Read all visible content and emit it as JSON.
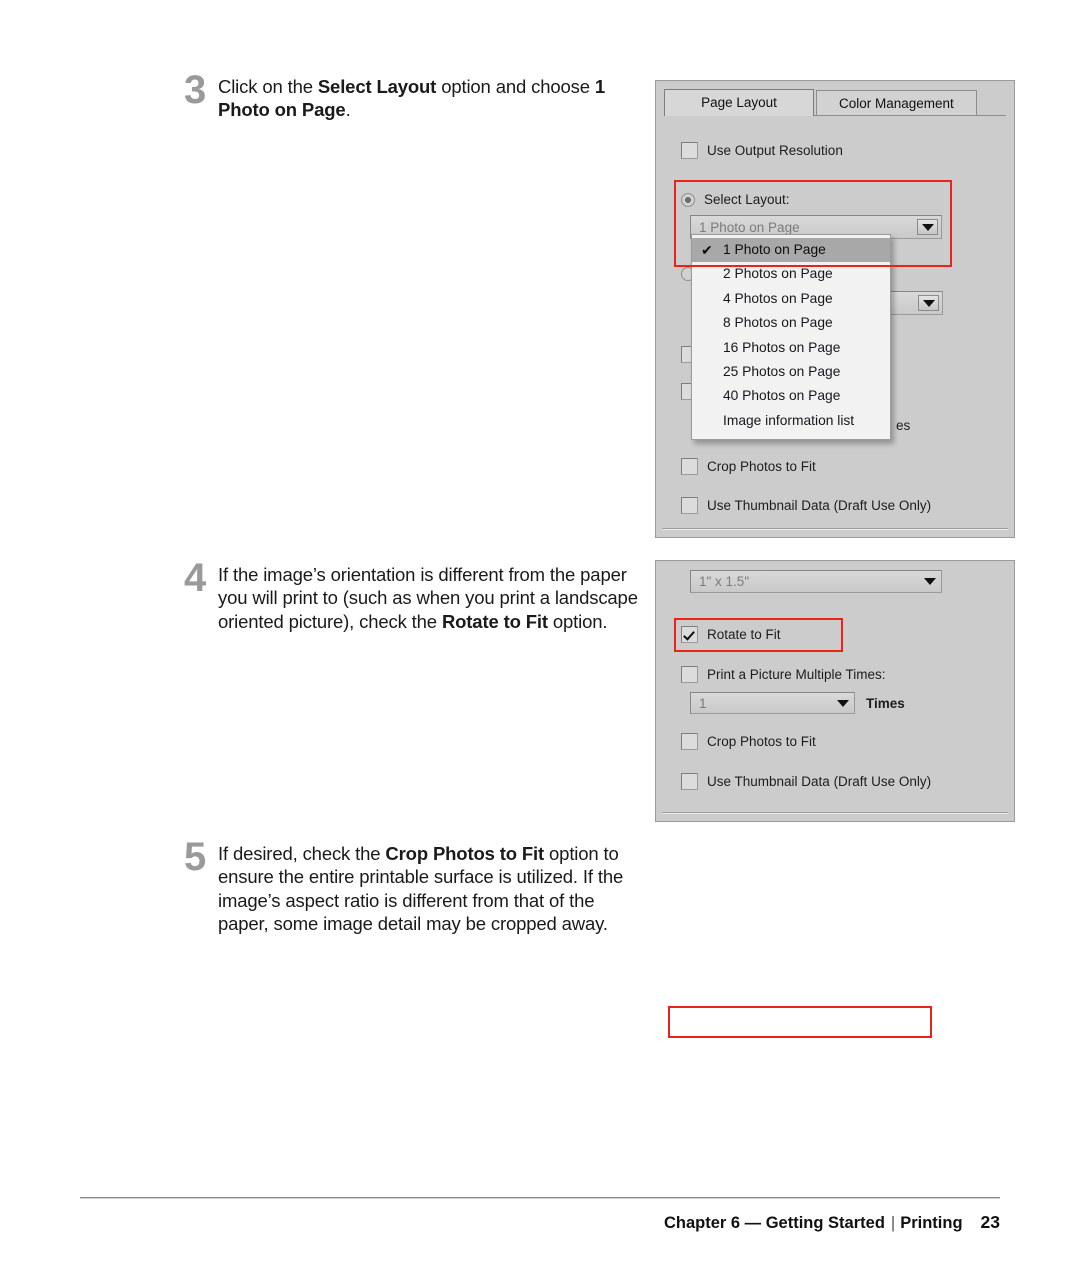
{
  "steps": [
    {
      "number": "3",
      "text_parts": [
        {
          "t": "Click on the ",
          "b": false
        },
        {
          "t": "Select Layout",
          "b": true
        },
        {
          "t": " option and choose ",
          "b": false
        },
        {
          "t": "1 Photo on Page",
          "b": true
        },
        {
          "t": ".",
          "b": false
        }
      ]
    },
    {
      "number": "4",
      "text_parts": [
        {
          "t": "If the image’s orientation is different from the paper you will print to (such as when you print a landscape oriented picture), check the ",
          "b": false
        },
        {
          "t": "Rotate to Fit",
          "b": true
        },
        {
          "t": " option.",
          "b": false
        }
      ]
    },
    {
      "number": "5",
      "text_parts": [
        {
          "t": "If desired, check the ",
          "b": false
        },
        {
          "t": "Crop Photos to Fit",
          "b": true
        },
        {
          "t": " option to ensure the entire printable surface is utilized. If the image’s aspect ratio is different from that of the paper, some image detail may be cropped away.",
          "b": false
        }
      ]
    }
  ],
  "dialog1": {
    "tabs": [
      {
        "label": "Page Layout",
        "active": true
      },
      {
        "label": "Color Management",
        "active": false
      }
    ],
    "use_output_resolution": {
      "label": "Use Output Resolution",
      "checked": false
    },
    "select_layout": {
      "label": "Select Layout:",
      "selected": true
    },
    "layout_combo": {
      "value": "1 Photo on Page"
    },
    "layout_options": [
      {
        "label": "1 Photo on Page",
        "selected": true,
        "check": "✔"
      },
      {
        "label": "2 Photos on Page",
        "selected": false
      },
      {
        "label": "4 Photos on Page",
        "selected": false
      },
      {
        "label": "8 Photos on Page",
        "selected": false
      },
      {
        "label": "16 Photos on Page",
        "selected": false
      },
      {
        "label": "25 Photos on Page",
        "selected": false
      },
      {
        "label": "40 Photos on Page",
        "selected": false
      },
      {
        "label": "Image information list",
        "selected": false
      }
    ],
    "partial_times_label": "es",
    "crop_photos": {
      "label": "Crop Photos to Fit",
      "checked": false
    },
    "use_thumbnail": {
      "label": "Use Thumbnail Data (Draft Use Only)",
      "checked": false
    }
  },
  "dialog2": {
    "size_combo": {
      "value": "1\" x 1.5\""
    },
    "rotate_to_fit": {
      "label": "Rotate to Fit",
      "checked": true
    },
    "print_multiple": {
      "label": "Print a Picture Multiple Times:",
      "checked": false
    },
    "times_combo": {
      "value": "1"
    },
    "times_label": "Times",
    "crop_photos": {
      "label": "Crop Photos to Fit",
      "checked": false
    },
    "use_thumbnail": {
      "label": "Use Thumbnail Data (Draft Use Only)",
      "checked": false
    }
  },
  "footer": {
    "chapter": "Chapter 6 — Getting Started",
    "separator": "|",
    "section": "Printing",
    "page": "23"
  },
  "colors": {
    "highlight_red": "#e8231c",
    "step_number_gray": "#9a9a9a",
    "dialog_bg": "#cccccc",
    "dropdown_bg": "#f2f2f2",
    "dropdown_selected": "#a8a8a8"
  }
}
